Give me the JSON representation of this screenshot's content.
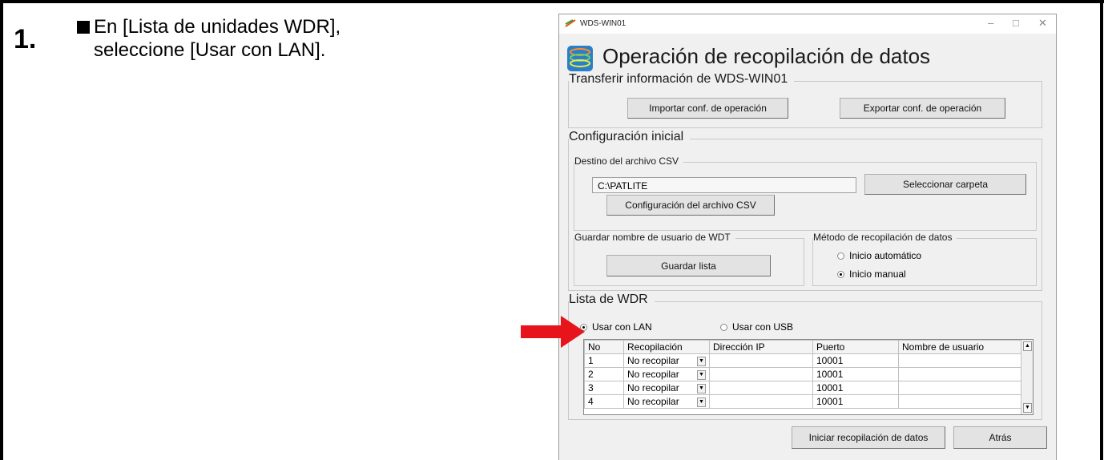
{
  "step": {
    "number": "1.",
    "instruction_line1": "En [Lista de unidades WDR],",
    "instruction_line2": "seleccione [Usar con LAN]."
  },
  "window": {
    "title": "WDS-WIN01",
    "controls": [
      "–",
      "□",
      "✕"
    ],
    "header_title": "Operación de recopilación de datos",
    "transfer": {
      "legend": "Transferir información de WDS-WIN01",
      "import_button": "Importar conf. de operación",
      "export_button": "Exportar conf. de operación"
    },
    "initial_config": {
      "legend": "Configuración inicial",
      "csv_dest_legend": "Destino del archivo CSV",
      "csv_path": "C:\\PATLITE",
      "select_folder_button": "Seleccionar carpeta",
      "csv_config_button": "Configuración del archivo CSV",
      "save_wdt_legend": "Guardar nombre de usuario de WDT",
      "save_list_button": "Guardar lista",
      "collection_method_legend": "Método de recopilación de datos",
      "auto_start": "Inicio automático",
      "manual_start": "Inicio manual",
      "selected_method": "manual"
    },
    "wdr_list": {
      "legend": "Lista de WDR",
      "use_lan": "Usar con LAN",
      "use_usb": "Usar con USB",
      "selected": "lan",
      "columns": [
        "No",
        "Recopilación",
        "Dirección IP",
        "Puerto",
        "Nombre de usuario"
      ],
      "rows": [
        {
          "no": "1",
          "collection": "No recopilar",
          "ip": "",
          "port": "10001",
          "user": ""
        },
        {
          "no": "2",
          "collection": "No recopilar",
          "ip": "",
          "port": "10001",
          "user": ""
        },
        {
          "no": "3",
          "collection": "No recopilar",
          "ip": "",
          "port": "10001",
          "user": ""
        },
        {
          "no": "4",
          "collection": "No recopilar",
          "ip": "",
          "port": "10001",
          "user": ""
        }
      ]
    },
    "start_button": "Iniciar recopilación de datos",
    "back_button": "Atrás"
  },
  "colors": {
    "arrow": "#e8141b",
    "window_bg": "#f0f0f0",
    "border": "#000000"
  },
  "icons": {
    "app": "app-logo-icon",
    "header": "data-collection-icon",
    "pointer": "red-arrow-icon"
  }
}
